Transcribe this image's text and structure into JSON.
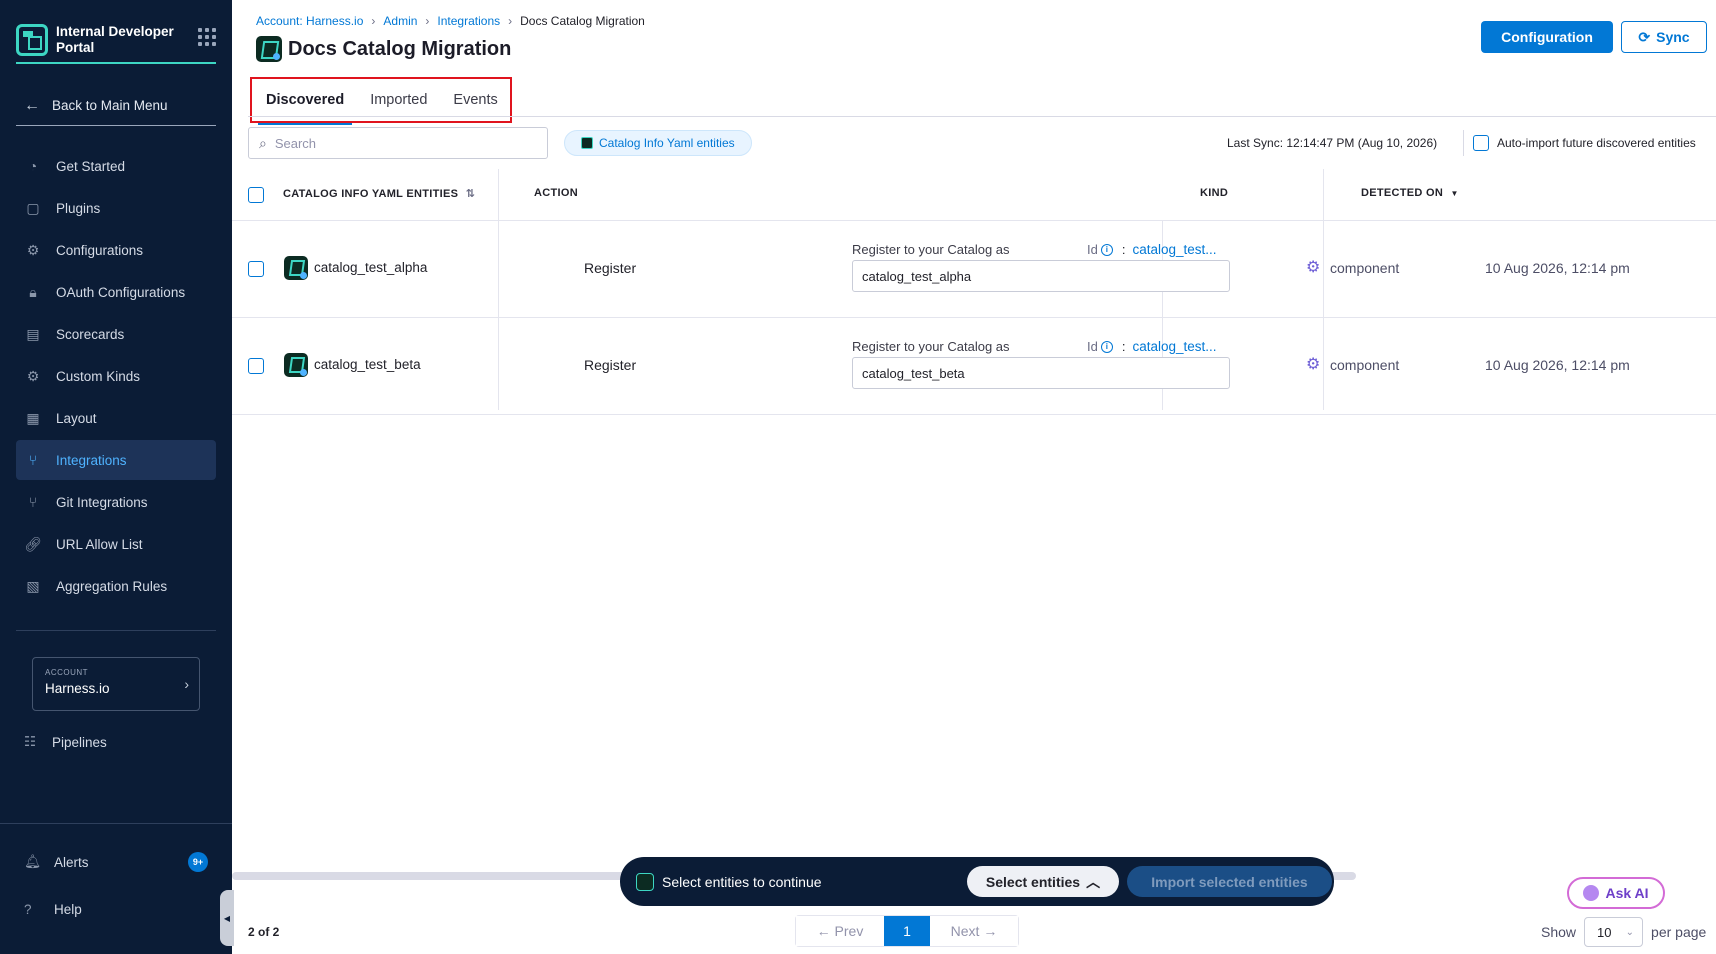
{
  "sidebar": {
    "brand_title": "Internal Developer Portal",
    "back_label": "Back to Main Menu",
    "items": [
      {
        "label": "Get Started",
        "icon": "get-started-icon"
      },
      {
        "label": "Plugins",
        "icon": "plugins-icon"
      },
      {
        "label": "Configurations",
        "icon": "configurations-icon"
      },
      {
        "label": "OAuth Configurations",
        "icon": "lock-icon"
      },
      {
        "label": "Scorecards",
        "icon": "scorecards-icon"
      },
      {
        "label": "Custom Kinds",
        "icon": "gear-icon"
      },
      {
        "label": "Layout",
        "icon": "layout-icon"
      },
      {
        "label": "Integrations",
        "icon": "integrations-icon",
        "active": true
      },
      {
        "label": "Git Integrations",
        "icon": "git-icon"
      },
      {
        "label": "URL Allow List",
        "icon": "link-icon"
      },
      {
        "label": "Aggregation Rules",
        "icon": "aggregation-icon"
      }
    ],
    "account_label": "ACCOUNT",
    "account_name": "Harness.io",
    "pipelines_label": "Pipelines",
    "alerts_label": "Alerts",
    "alerts_badge": "9+",
    "help_label": "Help"
  },
  "header": {
    "breadcrumb": [
      "Account: Harness.io",
      "Admin",
      "Integrations",
      "Docs Catalog Migration"
    ],
    "title": "Docs Catalog Migration",
    "configuration_label": "Configuration",
    "sync_label": "Sync"
  },
  "tabs": [
    {
      "label": "Discovered",
      "active": true
    },
    {
      "label": "Imported"
    },
    {
      "label": "Events"
    }
  ],
  "toolbar": {
    "search_placeholder": "Search",
    "filter_chip": "Catalog Info Yaml entities",
    "last_sync": "Last Sync: 12:14:47 PM (Aug 10, 2026)",
    "auto_import_label": "Auto-import future discovered entities"
  },
  "table": {
    "headers": {
      "entities": "CATALOG INFO YAML ENTITIES",
      "action": "ACTION",
      "kind": "KIND",
      "detected_on": "DETECTED ON"
    },
    "register_label": "Register to your Catalog as",
    "id_label": "Id",
    "rows": [
      {
        "name": "catalog_test_alpha",
        "action": "Register",
        "id_value": "catalog_test...",
        "register_value": "catalog_test_alpha",
        "kind": "component",
        "detected_on": "10 Aug 2026, 12:14 pm"
      },
      {
        "name": "catalog_test_beta",
        "action": "Register",
        "id_value": "catalog_test...",
        "register_value": "catalog_test_beta",
        "kind": "component",
        "detected_on": "10 Aug 2026, 12:14 pm"
      }
    ]
  },
  "selection_bar": {
    "message": "Select entities to continue",
    "select_label": "Select entities",
    "import_label": "Import selected entities"
  },
  "ask_ai_label": "Ask AI",
  "pagination": {
    "count": "2 of 2",
    "prev_label": "Prev",
    "current_page": "1",
    "next_label": "Next",
    "show_label": "Show",
    "per_page_value": "10",
    "per_page_label": "per page"
  },
  "colors": {
    "sidebar_bg": "#0b1c36",
    "accent": "#0278d5",
    "brand_teal": "#3dd6c3",
    "tab_highlight_box": "#e0141e"
  }
}
